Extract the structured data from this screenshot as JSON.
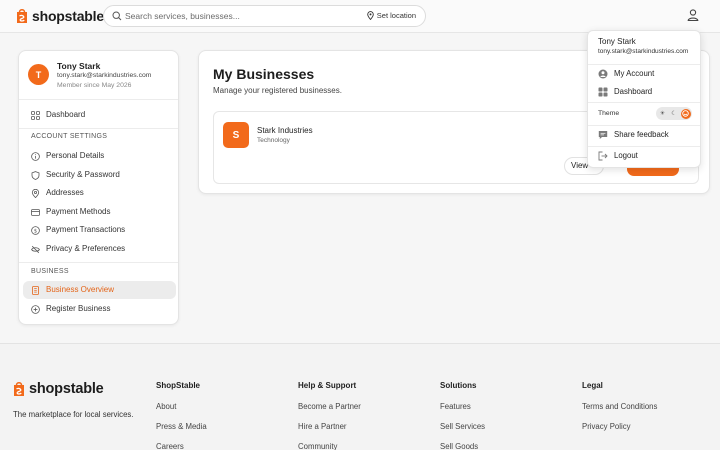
{
  "brand": {
    "name": "shopstable",
    "color": "#f26a1b"
  },
  "header": {
    "search_placeholder": "Search services, businesses...",
    "location_label": "Set location"
  },
  "sidebar": {
    "user": {
      "initial": "T",
      "name": "Tony Stark",
      "email": "tony.stark@starkindustries.com",
      "member_since": "Member since May 2026"
    },
    "dashboard_label": "Dashboard",
    "account_heading": "ACCOUNT SETTINGS",
    "account_items": [
      {
        "label": "Personal Details",
        "icon": "info-icon"
      },
      {
        "label": "Security & Password",
        "icon": "shield-icon"
      },
      {
        "label": "Addresses",
        "icon": "map-pin-icon"
      },
      {
        "label": "Payment Methods",
        "icon": "credit-card-icon"
      },
      {
        "label": "Payment Transactions",
        "icon": "dollar-circle-icon"
      },
      {
        "label": "Privacy & Preferences",
        "icon": "eye-off-icon"
      }
    ],
    "business_heading": "BUSINESS",
    "business_items": [
      {
        "label": "Business Overview",
        "icon": "building-icon",
        "active": true
      },
      {
        "label": "Register Business",
        "icon": "plus-circle-icon",
        "active": false
      }
    ]
  },
  "main": {
    "title": "My Businesses",
    "subtitle": "Manage your registered businesses.",
    "business": {
      "initial": "S",
      "name": "Stark Industries",
      "type": "Technology",
      "view_label": "View"
    }
  },
  "menu": {
    "name": "Tony Stark",
    "email": "tony.stark@starkindustries.com",
    "my_account": "My Account",
    "dashboard": "Dashboard",
    "theme_label": "Theme",
    "share_feedback": "Share feedback",
    "logout": "Logout",
    "theme_selected": "system"
  },
  "footer": {
    "brand": "shopstable",
    "tagline": "The marketplace for local services.",
    "columns": [
      {
        "title": "ShopStable",
        "links": [
          "About",
          "Press & Media",
          "Careers"
        ]
      },
      {
        "title": "Help & Support",
        "links": [
          "Become a Partner",
          "Hire a Partner",
          "Community"
        ]
      },
      {
        "title": "Solutions",
        "links": [
          "Features",
          "Sell Services",
          "Sell Goods"
        ]
      },
      {
        "title": "Legal",
        "links": [
          "Terms and Conditions",
          "Privacy Policy"
        ]
      }
    ]
  }
}
